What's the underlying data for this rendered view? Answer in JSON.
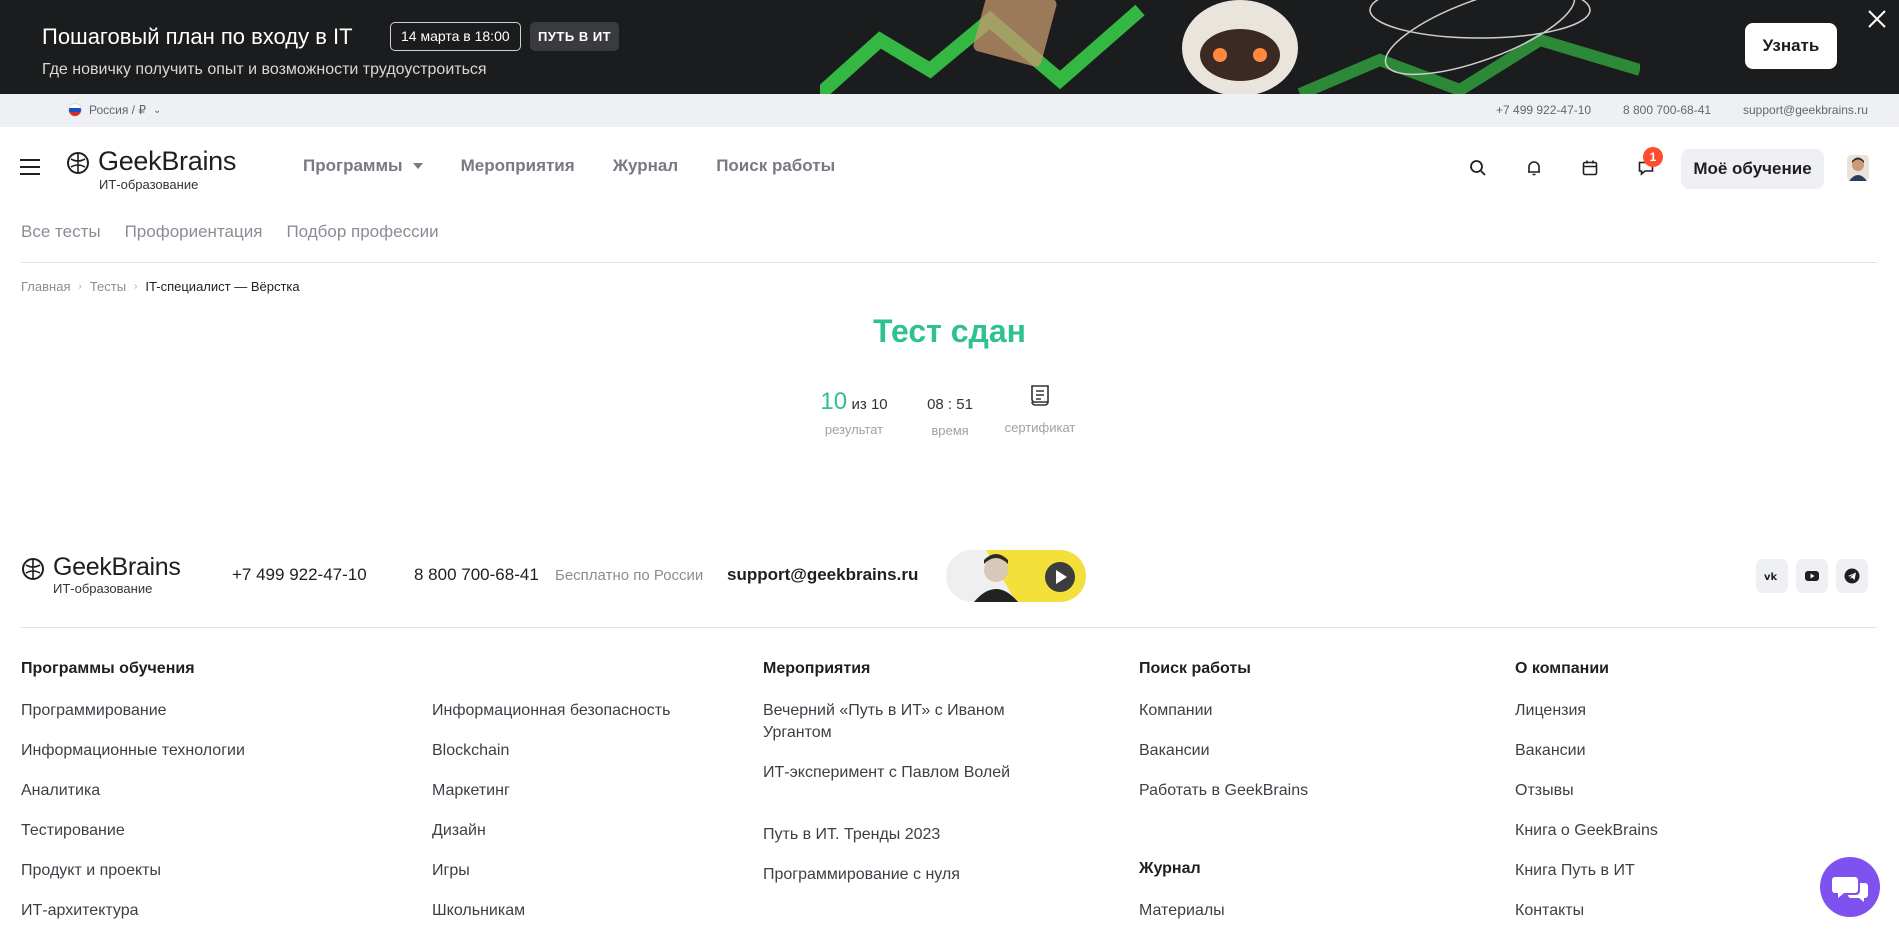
{
  "promo": {
    "title": "Пошаговый план по входу в IT",
    "subtitle": "Где новичку получить опыт и возможности трудоустроиться",
    "date": "14 марта в 18:00",
    "brand": "ПУТЬ В ИТ",
    "cta": "Узнать"
  },
  "topstrip": {
    "region": "Россия / ₽",
    "phone1": "+7 499 922-47-10",
    "phone2": "8 800 700-68-41",
    "email": "support@geekbrains.ru"
  },
  "logo": {
    "name": "GeekBrains",
    "sub": "ИТ-образование"
  },
  "nav": [
    "Программы",
    "Мероприятия",
    "Журнал",
    "Поиск работы"
  ],
  "header": {
    "notifications_count": "1",
    "my_learning": "Моё обучение"
  },
  "subnav": [
    "Все тесты",
    "Профориентация",
    "Подбор профессии"
  ],
  "breadcrumbs": {
    "home": "Главная",
    "tests": "Тесты",
    "current": "IT-специалист — Вёрстка"
  },
  "result": {
    "title": "Тест сдан",
    "score": "10",
    "score_of": "из 10",
    "score_label": "результат",
    "time": "08 : 51",
    "time_label": "время",
    "certificate_label": "сертификат"
  },
  "footer": {
    "phone1": "+7 499 922-47-10",
    "phone2": "8 800 700-68-41",
    "free_note": "Бесплатно по России",
    "email": "support@geekbrains.ru",
    "programs_title": "Программы обучения",
    "programs_col1": [
      "Программирование",
      "Информационные технологии",
      "Аналитика",
      "Тестирование",
      "Продукт и проекты",
      "ИТ-архитектура"
    ],
    "programs_col2": [
      "Информационная безопасность",
      "Blockchain",
      "Маркетинг",
      "Дизайн",
      "Игры",
      "Школьникам"
    ],
    "events_title": "Мероприятия",
    "events": [
      "Вечерний «Путь в ИТ» с Иваном Ургантом",
      "ИТ-эксперимент с Павлом Волей",
      "Путь в ИТ. Тренды 2023",
      "Программирование с нуля"
    ],
    "jobs_title": "Поиск работы",
    "jobs": [
      "Компании",
      "Вакансии",
      "Работать в GeekBrains"
    ],
    "journal_title": "Журнал",
    "journal": [
      "Материалы"
    ],
    "company_title": "О компании",
    "company": [
      "Лицензия",
      "Вакансии",
      "Отзывы",
      "Книга о GeekBrains",
      "Книга Путь в ИТ",
      "Контакты"
    ]
  },
  "colors": {
    "accent_green": "#2fc18e",
    "chat_purple": "#7f52f0",
    "badge_red": "#ff4d2e"
  }
}
